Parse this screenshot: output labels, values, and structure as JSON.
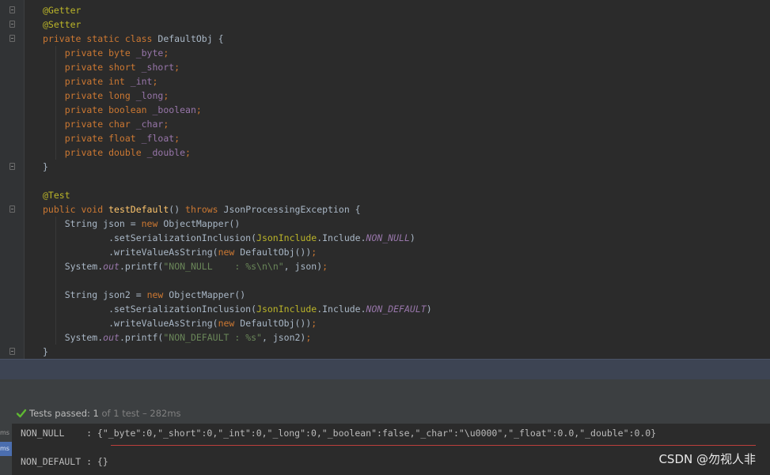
{
  "editor": {
    "lines": [
      [
        [
          "@Getter",
          "ann"
        ]
      ],
      [
        [
          "@Setter",
          "ann"
        ]
      ],
      [
        [
          "private static class ",
          "kw"
        ],
        [
          "DefaultObj {",
          ""
        ]
      ],
      [
        [
          "    private byte ",
          "kw"
        ],
        [
          "_byte",
          "field"
        ],
        [
          ";",
          "kw"
        ]
      ],
      [
        [
          "    private short ",
          "kw"
        ],
        [
          "_short",
          "field"
        ],
        [
          ";",
          "kw"
        ]
      ],
      [
        [
          "    private int ",
          "kw"
        ],
        [
          "_int",
          "field"
        ],
        [
          ";",
          "kw"
        ]
      ],
      [
        [
          "    private long ",
          "kw"
        ],
        [
          "_long",
          "field"
        ],
        [
          ";",
          "kw"
        ]
      ],
      [
        [
          "    private boolean ",
          "kw"
        ],
        [
          "_boolean",
          "field"
        ],
        [
          ";",
          "kw"
        ]
      ],
      [
        [
          "    private char ",
          "kw"
        ],
        [
          "_char",
          "field"
        ],
        [
          ";",
          "kw"
        ]
      ],
      [
        [
          "    private float ",
          "kw"
        ],
        [
          "_float",
          "field"
        ],
        [
          ";",
          "kw"
        ]
      ],
      [
        [
          "    private double ",
          "kw"
        ],
        [
          "_double",
          "field"
        ],
        [
          ";",
          "kw"
        ]
      ],
      [
        [
          "}",
          ""
        ]
      ],
      [
        [
          "",
          ""
        ]
      ],
      [
        [
          "@Test",
          "ann"
        ]
      ],
      [
        [
          "public void ",
          "kw"
        ],
        [
          "testDefault",
          "fn"
        ],
        [
          "() ",
          ""
        ],
        [
          "throws ",
          "kw"
        ],
        [
          "JsonProcessingException {",
          ""
        ]
      ],
      [
        [
          "    String json = ",
          ""
        ],
        [
          "new ",
          "kw"
        ],
        [
          "ObjectMapper()",
          ""
        ]
      ],
      [
        [
          "            .setSerializationInclusion(",
          ""
        ],
        [
          "JsonInclude",
          "ycls"
        ],
        [
          ".Include.",
          ""
        ],
        [
          "NON_NULL",
          "static"
        ],
        [
          ")",
          ""
        ]
      ],
      [
        [
          "            .writeValueAsString(",
          ""
        ],
        [
          "new ",
          "kw"
        ],
        [
          "DefaultObj())",
          ""
        ],
        [
          ";",
          "kw"
        ]
      ],
      [
        [
          "    System.",
          ""
        ],
        [
          "out",
          "static"
        ],
        [
          ".printf(",
          ""
        ],
        [
          "\"NON_NULL    : %s\\n\\n\"",
          "str"
        ],
        [
          ", json)",
          ""
        ],
        [
          ";",
          "kw"
        ]
      ],
      [
        [
          "",
          ""
        ]
      ],
      [
        [
          "    String json2 = ",
          ""
        ],
        [
          "new ",
          "kw"
        ],
        [
          "ObjectMapper()",
          ""
        ]
      ],
      [
        [
          "            .setSerializationInclusion(",
          ""
        ],
        [
          "JsonInclude",
          "ycls"
        ],
        [
          ".Include.",
          ""
        ],
        [
          "NON_DEFAULT",
          "static"
        ],
        [
          ")",
          ""
        ]
      ],
      [
        [
          "            .writeValueAsString(",
          ""
        ],
        [
          "new ",
          "kw"
        ],
        [
          "DefaultObj())",
          ""
        ],
        [
          ";",
          "kw"
        ]
      ],
      [
        [
          "    System.",
          ""
        ],
        [
          "out",
          "static"
        ],
        [
          ".printf(",
          ""
        ],
        [
          "\"NON_DEFAULT : %s\"",
          "str"
        ],
        [
          ", json2)",
          ""
        ],
        [
          ";",
          "kw"
        ]
      ],
      [
        [
          "}",
          ""
        ]
      ]
    ]
  },
  "status": {
    "icon": "checkmark-icon",
    "label": "Tests passed:",
    "passed": "1",
    "rest": "of 1 test",
    "sep": "–",
    "time": "282ms"
  },
  "console": {
    "time_tags": [
      "ms",
      "ms"
    ],
    "line1": "NON_NULL    : {\"_byte\":0,\"_short\":0,\"_int\":0,\"_long\":0,\"_boolean\":false,\"_char\":\"\\u0000\",\"_float\":0.0,\"_double\":0.0}",
    "line2": "NON_DEFAULT : {}"
  },
  "watermark": "CSDN @勿视人非",
  "colors": {
    "editor_bg": "#2b2b2b",
    "keyword": "#cc7832",
    "annotation": "#bbb529",
    "field": "#9876aa",
    "string": "#6a8759",
    "method": "#ffc66d",
    "pass_green": "#5fb832",
    "error_underline": "#bc3f3c"
  }
}
